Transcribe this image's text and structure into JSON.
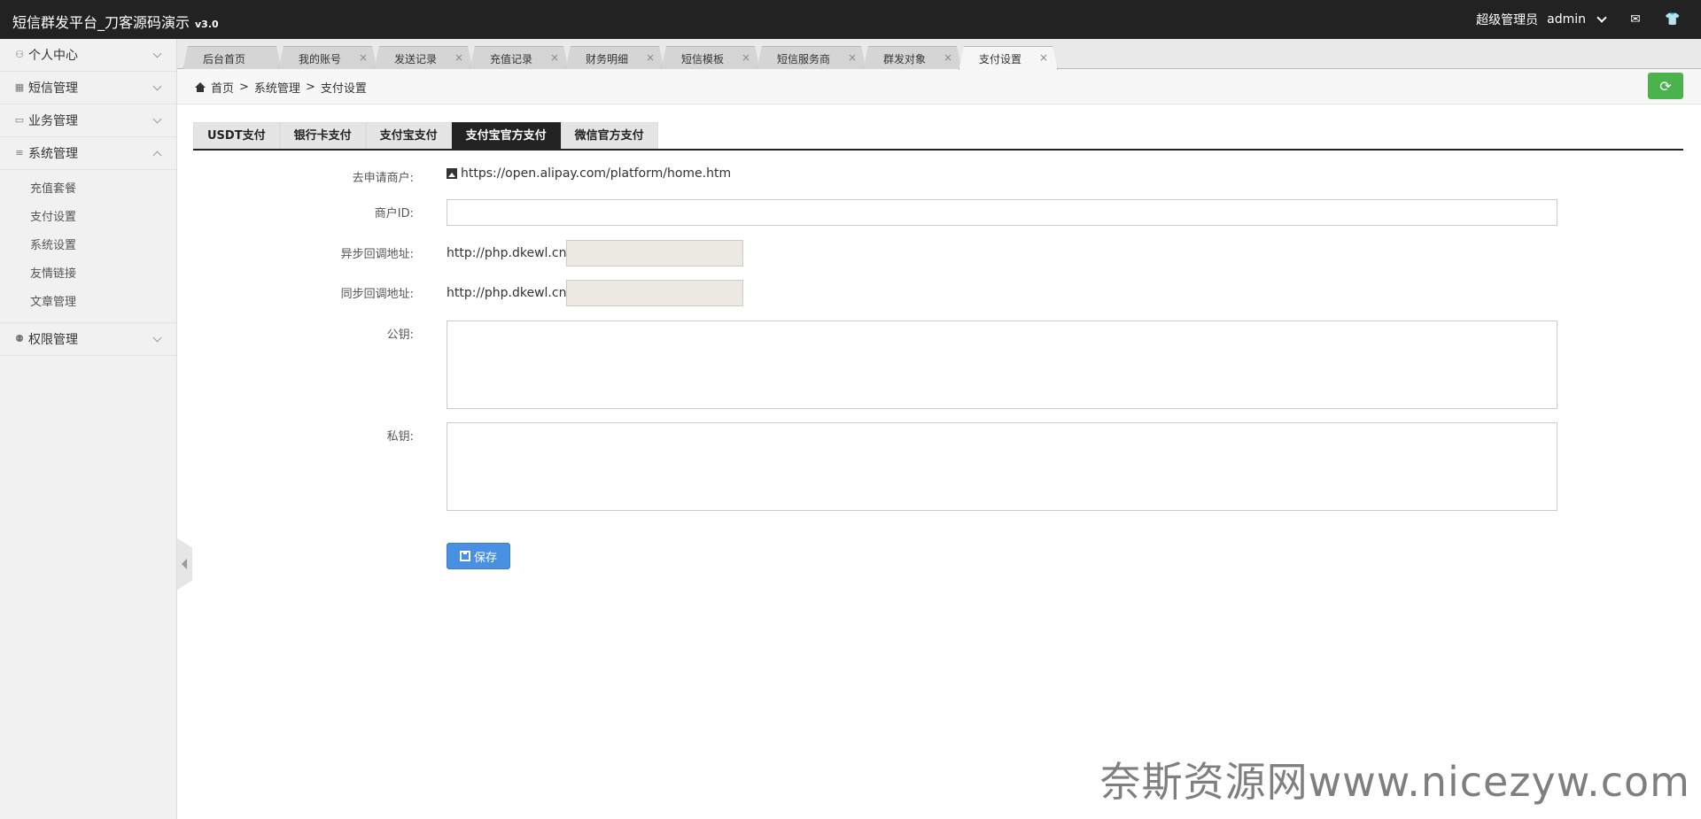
{
  "app": {
    "title": "短信群发平台_刀客源码演示",
    "version": "v3.0"
  },
  "topbar": {
    "role": "超级管理员",
    "user": "admin",
    "icons": [
      "mail-icon",
      "tshirt-icon"
    ]
  },
  "sidebar": {
    "items": [
      {
        "label": "个人中心",
        "icon": "user-icon"
      },
      {
        "label": "短信管理",
        "icon": "grid-icon"
      },
      {
        "label": "业务管理",
        "icon": "inbox-icon"
      },
      {
        "label": "系统管理",
        "icon": "database-icon"
      },
      {
        "label": "权限管理",
        "icon": "users-icon"
      }
    ],
    "sub_items": [
      "充值套餐",
      "支付设置",
      "系统设置",
      "友情链接",
      "文章管理"
    ]
  },
  "tabs": [
    {
      "label": "后台首页"
    },
    {
      "label": "我的账号"
    },
    {
      "label": "发送记录"
    },
    {
      "label": "充值记录"
    },
    {
      "label": "财务明细"
    },
    {
      "label": "短信模板"
    },
    {
      "label": "短信服务商"
    },
    {
      "label": "群发对象"
    },
    {
      "label": "支付设置"
    }
  ],
  "tab_close_glyph": "×",
  "breadcrumb": {
    "home": "首页",
    "sep": ">",
    "level1": "系统管理",
    "level2": "支付设置"
  },
  "content_tabs": [
    "USDT支付",
    "银行卡支付",
    "支付宝支付",
    "支付宝官方支付",
    "微信官方支付"
  ],
  "active_content_tab": "支付宝官方支付",
  "form": {
    "apply_label": "去申请商户:",
    "apply_link": "https://open.alipay.com/platform/home.htm",
    "merchant_label": "商户ID:",
    "merchant_value": "",
    "async_label": "异步回调地址:",
    "async_prefix": "http://php.dkewl.cn",
    "async_value": "",
    "sync_label": "同步回调地址:",
    "sync_prefix": "http://php.dkewl.cn",
    "sync_value": "",
    "pubkey_label": "公钥:",
    "pubkey_value": "",
    "privkey_label": "私钥:",
    "privkey_value": "",
    "save_label": "保存"
  },
  "watermark": "奈斯资源网www.nicezyw.com",
  "colors": {
    "topbar": "#222222",
    "refresh": "#4bb34b",
    "save": "#4a90e2",
    "active_tab": "#222222"
  }
}
